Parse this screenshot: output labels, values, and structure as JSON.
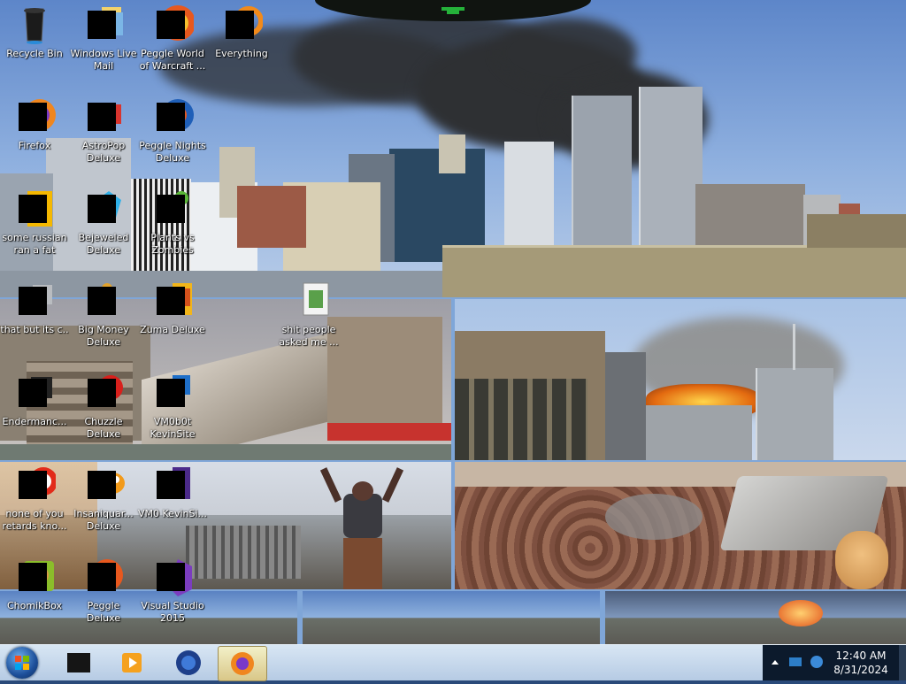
{
  "desktop": {
    "icons": [
      {
        "label": "Recycle Bin",
        "icon": "recycle-bin-icon"
      },
      {
        "label": "Windows Live Mail",
        "icon": "mail-icon"
      },
      {
        "label": "Peggle World of Warcraft ...",
        "icon": "peggle-icon"
      },
      {
        "label": "Everything",
        "icon": "everything-icon"
      },
      {
        "label": "Firefox",
        "icon": "firefox-icon"
      },
      {
        "label": "AstroPop Deluxe",
        "icon": "astropop-icon"
      },
      {
        "label": "Peggle Nights Deluxe",
        "icon": "peggle-nights-icon"
      },
      {
        "label": "some russian ran a fat",
        "icon": "file-icon"
      },
      {
        "label": "Bejeweled Deluxe",
        "icon": "bejeweled-icon"
      },
      {
        "label": "Plants vs Zombies",
        "icon": "plants-vs-zombies-icon"
      },
      {
        "label": "that but its c..",
        "icon": "file-icon"
      },
      {
        "label": "Big Money Deluxe",
        "icon": "big-money-icon"
      },
      {
        "label": "Zuma Deluxe",
        "icon": "zuma-icon"
      },
      {
        "label": "shit people asked me ...",
        "icon": "folder-icon"
      },
      {
        "label": "Endermanc...",
        "icon": "file-icon"
      },
      {
        "label": "Chuzzle Deluxe",
        "icon": "chuzzle-icon"
      },
      {
        "label": "VM0b0t KevinSite",
        "icon": "vm-icon"
      },
      {
        "label": "none of you retards kno...",
        "icon": "file-icon"
      },
      {
        "label": "Insaniquar... Deluxe",
        "icon": "insaniquarium-icon"
      },
      {
        "label": "VM0 KevinSi...",
        "icon": "vm-icon"
      },
      {
        "label": "ChomikBox",
        "icon": "chomikbox-icon"
      },
      {
        "label": "Peggle Deluxe",
        "icon": "peggle-icon"
      },
      {
        "label": "Visual Studio 2015",
        "icon": "visual-studio-icon"
      }
    ]
  },
  "taskbar": {
    "start_icon": "windows-start-orb-icon",
    "pinned": [
      {
        "icon": "dark-app-icon",
        "active": false
      },
      {
        "icon": "media-player-icon",
        "active": false
      },
      {
        "icon": "globe-browser-icon",
        "active": false
      },
      {
        "icon": "firefox-icon",
        "active": true
      }
    ],
    "tray_icons": [
      "show-hidden-icons-chevron",
      "network-icon",
      "volume-icon"
    ],
    "clock": {
      "time": "12:40 AM",
      "date": "8/31/2024"
    }
  },
  "colors": {
    "taskbar": "#c6d8ec",
    "tray": "#0c1a2c",
    "active_task": "#e8dfa8",
    "label_text": "#ffffff"
  }
}
